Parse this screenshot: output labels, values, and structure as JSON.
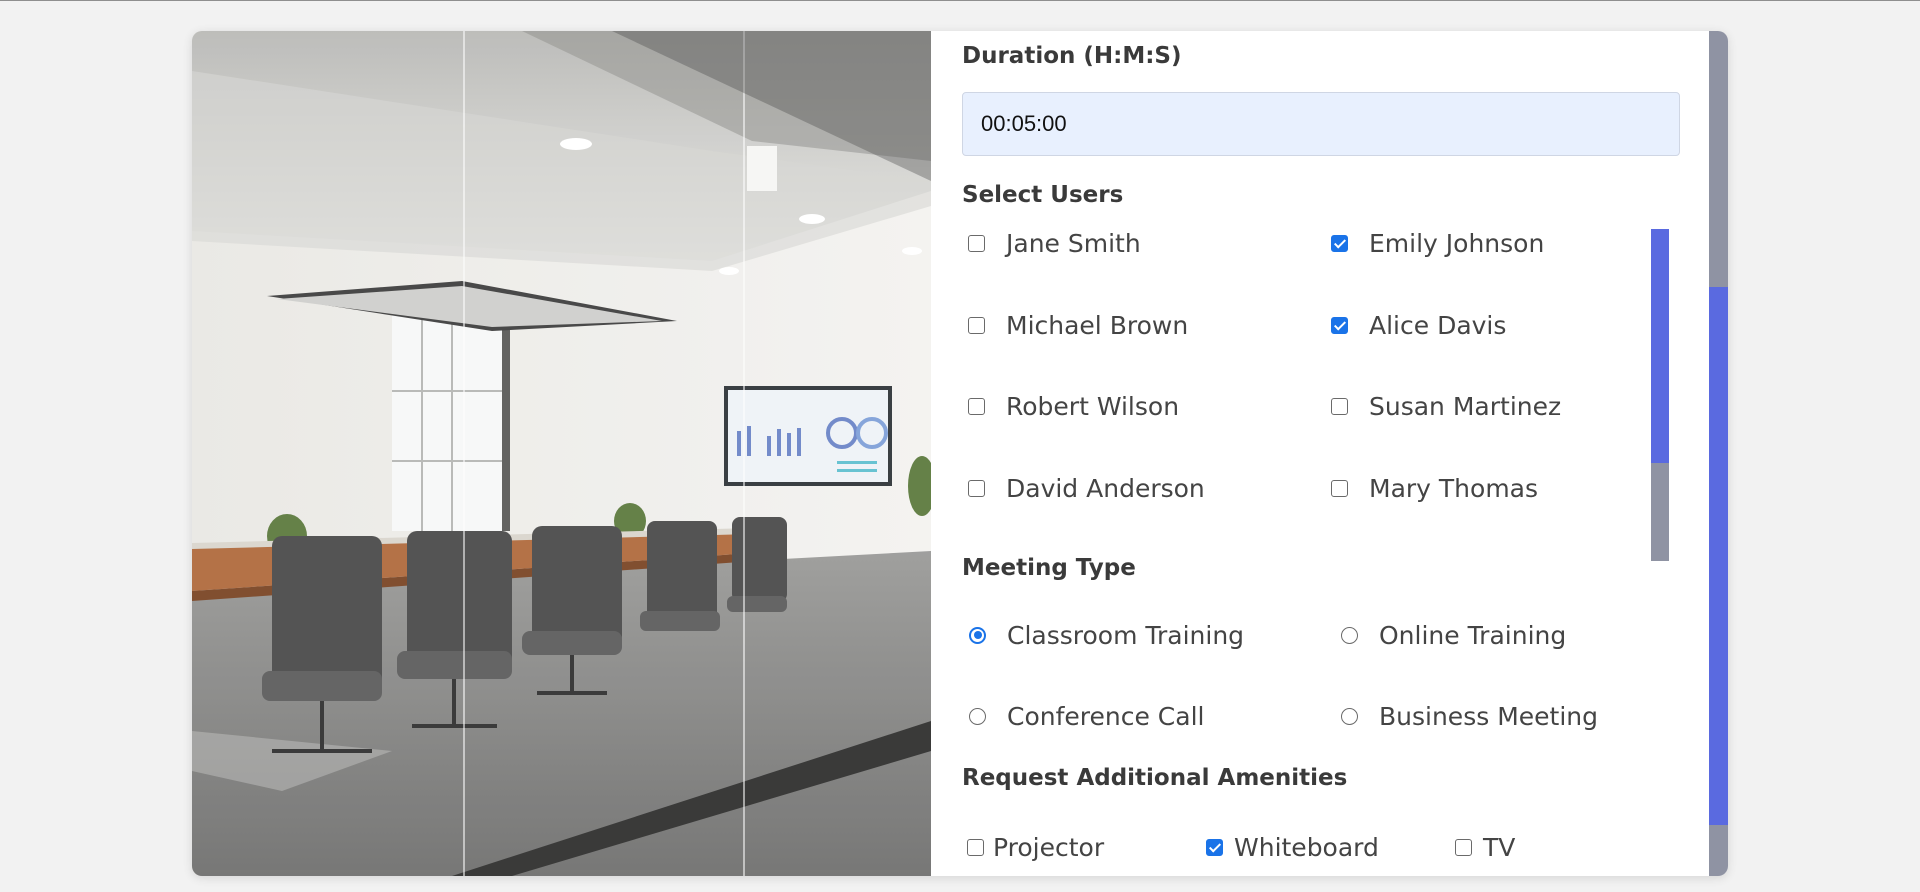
{
  "form": {
    "duration": {
      "label": "Duration (H:M:S)",
      "value": "00:05:00"
    },
    "select_users": {
      "label": "Select Users",
      "users": [
        {
          "name": "Jane Smith",
          "checked": false
        },
        {
          "name": "Emily Johnson",
          "checked": true
        },
        {
          "name": "Michael Brown",
          "checked": false
        },
        {
          "name": "Alice Davis",
          "checked": true
        },
        {
          "name": "Robert Wilson",
          "checked": false
        },
        {
          "name": "Susan Martinez",
          "checked": false
        },
        {
          "name": "David Anderson",
          "checked": false
        },
        {
          "name": "Mary Thomas",
          "checked": false
        }
      ]
    },
    "meeting_type": {
      "label": "Meeting Type",
      "options": [
        {
          "label": "Classroom Training",
          "selected": true
        },
        {
          "label": "Online Training",
          "selected": false
        },
        {
          "label": "Conference Call",
          "selected": false
        },
        {
          "label": "Business Meeting",
          "selected": false
        }
      ]
    },
    "amenities": {
      "label": "Request Additional Amenities",
      "options": [
        {
          "label": "Projector",
          "checked": false
        },
        {
          "label": "Whiteboard",
          "checked": true
        },
        {
          "label": "TV",
          "checked": false
        }
      ]
    }
  },
  "colors": {
    "accent": "#1a73e8",
    "scrollbar_thumb": "#5a6ae0",
    "scrollbar_track": "#8f93a3",
    "input_bg": "#e8f0fe",
    "page_bg": "#f2f2f2"
  }
}
